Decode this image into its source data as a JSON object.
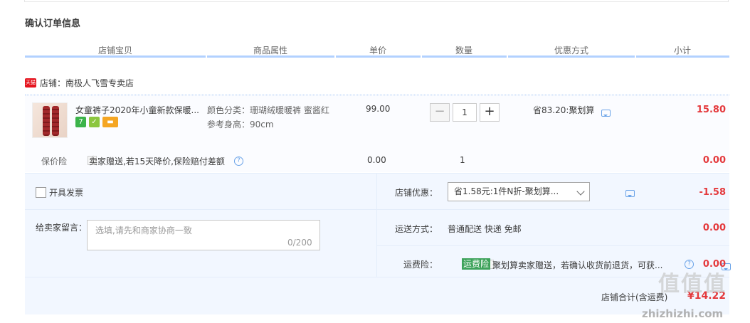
{
  "section_title": "确认订单信息",
  "columns": [
    "店铺宝贝",
    "商品属性",
    "单价",
    "数量",
    "优惠方式",
    "小计"
  ],
  "shop": {
    "badge": "天猫",
    "name": "店铺：南极人飞雪专卖店"
  },
  "item": {
    "title": "女童裤子2020年小童新款保暖...",
    "attr_color": "颜色分类：珊瑚绒暖暖裤 蜜酱红",
    "attr_size": "参考身高：90cm",
    "price": "99.00",
    "quantity": "1",
    "promo": "省83.20:聚划算",
    "subtotal": "15.80",
    "minus": "−",
    "plus": "+"
  },
  "insurance": {
    "label": "保价险",
    "desc": "卖家赠送,若15天降价,保险赔付差额",
    "price": "0.00",
    "quantity": "1",
    "subtotal": "0.00"
  },
  "invoice": {
    "label": "开具发票"
  },
  "shop_discount": {
    "label": "店铺优惠：",
    "selected": "省1.58元:1件N折-聚划算...",
    "amount": "-1.58"
  },
  "memo": {
    "label": "给卖家留言：",
    "placeholder": "选填,请先和商家协商一致",
    "count": "0/200"
  },
  "shipping": {
    "label": "运送方式：",
    "value": "普通配送 快递 免邮",
    "amount": "0.00"
  },
  "freight_insurance": {
    "label": "运费险：",
    "tag": "运费险",
    "desc": "聚划算卖家赠送，若确认收货前退货，可获...",
    "amount": "0.00"
  },
  "total": {
    "label": "店铺合计(含运费)",
    "amount": "¥14.22"
  },
  "watermark": {
    "text": "值值值",
    "sub": "zhizhizhi.com"
  },
  "colors": {
    "price_red": "#e4393c",
    "header_line": "#b2d1ff",
    "panel_bg": "#f2f7ff",
    "tag_green": "#3ea35b"
  }
}
